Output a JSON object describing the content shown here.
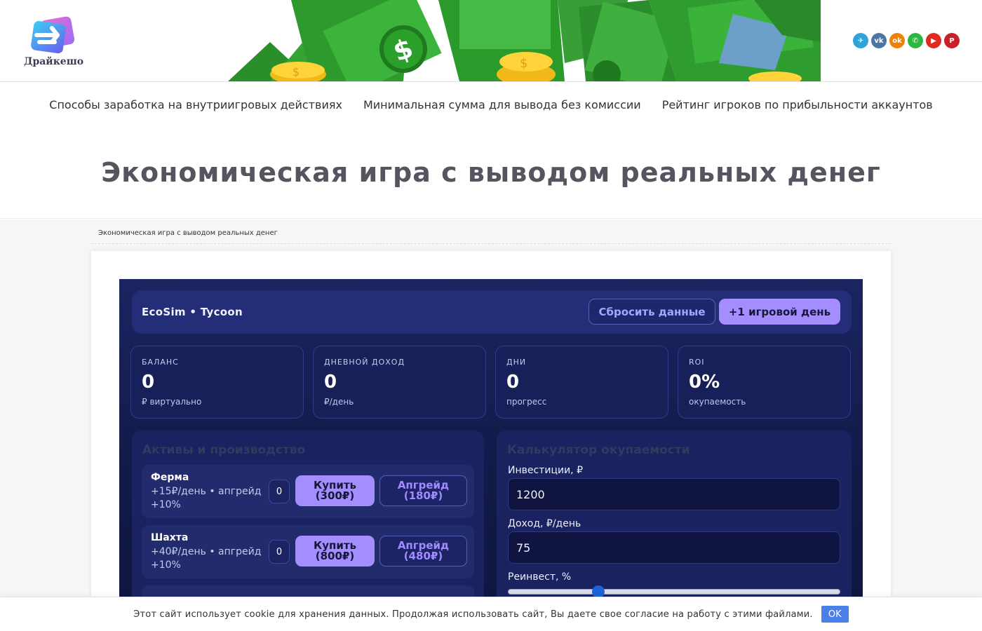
{
  "site": {
    "logo_text": "Драйкешо"
  },
  "social": [
    {
      "icon": "telegram-icon",
      "glyph": "✈",
      "color": "#30a3d8"
    },
    {
      "icon": "vk-icon",
      "glyph": "vk",
      "color": "#4c75a3"
    },
    {
      "icon": "odnoklassniki-icon",
      "glyph": "ok",
      "color": "#ee8208"
    },
    {
      "icon": "whatsapp-icon",
      "glyph": "✆",
      "color": "#2cb742"
    },
    {
      "icon": "youtube-icon",
      "glyph": "▶",
      "color": "#e02a20"
    },
    {
      "icon": "pinterest-icon",
      "glyph": "P",
      "color": "#cb2027"
    }
  ],
  "nav": {
    "items": [
      "Способы заработка на внутриигровых действиях",
      "Минимальная сумма для вывода без комиссии",
      "Рейтинг игроков по прибыльности аккаунтов"
    ]
  },
  "page": {
    "title": "Экономическая игра с выводом реальных денег",
    "breadcrumb": "Экономическая игра с выводом реальных денег"
  },
  "app": {
    "brand": "EcoSim • Tycoon",
    "reset_label": "Сбросить данные",
    "next_day_label": "+1 игровой день",
    "stats": [
      {
        "label": "БАЛАНС",
        "value": "0",
        "sub": "₽ виртуально"
      },
      {
        "label": "ДНЕВНОЙ ДОХОД",
        "value": "0",
        "sub": "₽/день"
      },
      {
        "label": "ДНИ",
        "value": "0",
        "sub": "прогресс"
      },
      {
        "label": "ROI",
        "value": "0%",
        "sub": "окупаемость"
      }
    ],
    "assets_title": "Активы и производство",
    "assets": [
      {
        "name": "Ферма",
        "desc": "+15₽/день • апгрейд +10%",
        "count": "0",
        "buy": "Купить (300₽)",
        "upgrade": "Апгрейд (180₽)"
      },
      {
        "name": "Шахта",
        "desc": "+40₽/день • апгрейд +10%",
        "count": "0",
        "buy": "Купить (800₽)",
        "upgrade": "Апгрейд (480₽)"
      }
    ],
    "calc": {
      "title": "Калькулятор окупаемости",
      "investment_label": "Инвестиции, ₽",
      "investment_value": "1200",
      "income_label": "Доход, ₽/день",
      "income_value": "75",
      "reinvest_label": "Реинвест, %",
      "reinvest_level": 0.26
    }
  },
  "cookie": {
    "text": "Этот сайт использует cookie для хранения данных. Продолжая использовать сайт, Вы даете свое согласие на работу с этими файлами.",
    "ok_label": "OK"
  }
}
